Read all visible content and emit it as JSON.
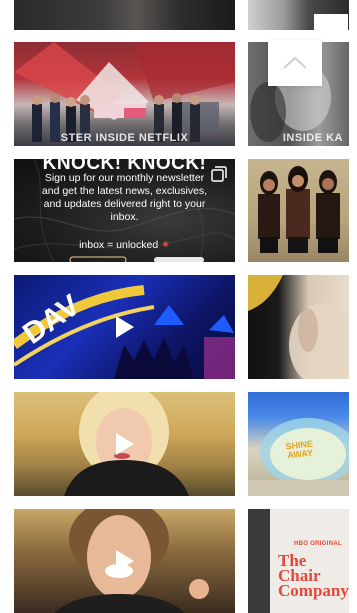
{
  "page": {
    "background": "#ffffff"
  },
  "tiles": {
    "netflix_sign": {
      "caption": "STER INSIDE NETFLIX"
    },
    "inside_ka": {
      "caption": "INSIDE KA"
    },
    "newsletter": {
      "title": "KNOCK! KNOCK!",
      "body": "Sign up for our monthly newsletter and get the latest news, exclusives, and updates delivered right to your inbox.",
      "inbox": "inbox = unlocked"
    },
    "shine_away": {
      "line1": "SHINE",
      "line2": "AWAY"
    },
    "chair_company": {
      "hbo": "HBO ORIGINAL",
      "line1": "The Chair",
      "line2": "Company"
    }
  },
  "icons": {
    "play": "play-icon",
    "carousel": "multiple-images-icon",
    "scroll_top": "chevron-up-icon"
  },
  "colors": {
    "play": "#ffffff",
    "accent_red": "#e4473b",
    "gold": "#e7a21c"
  }
}
